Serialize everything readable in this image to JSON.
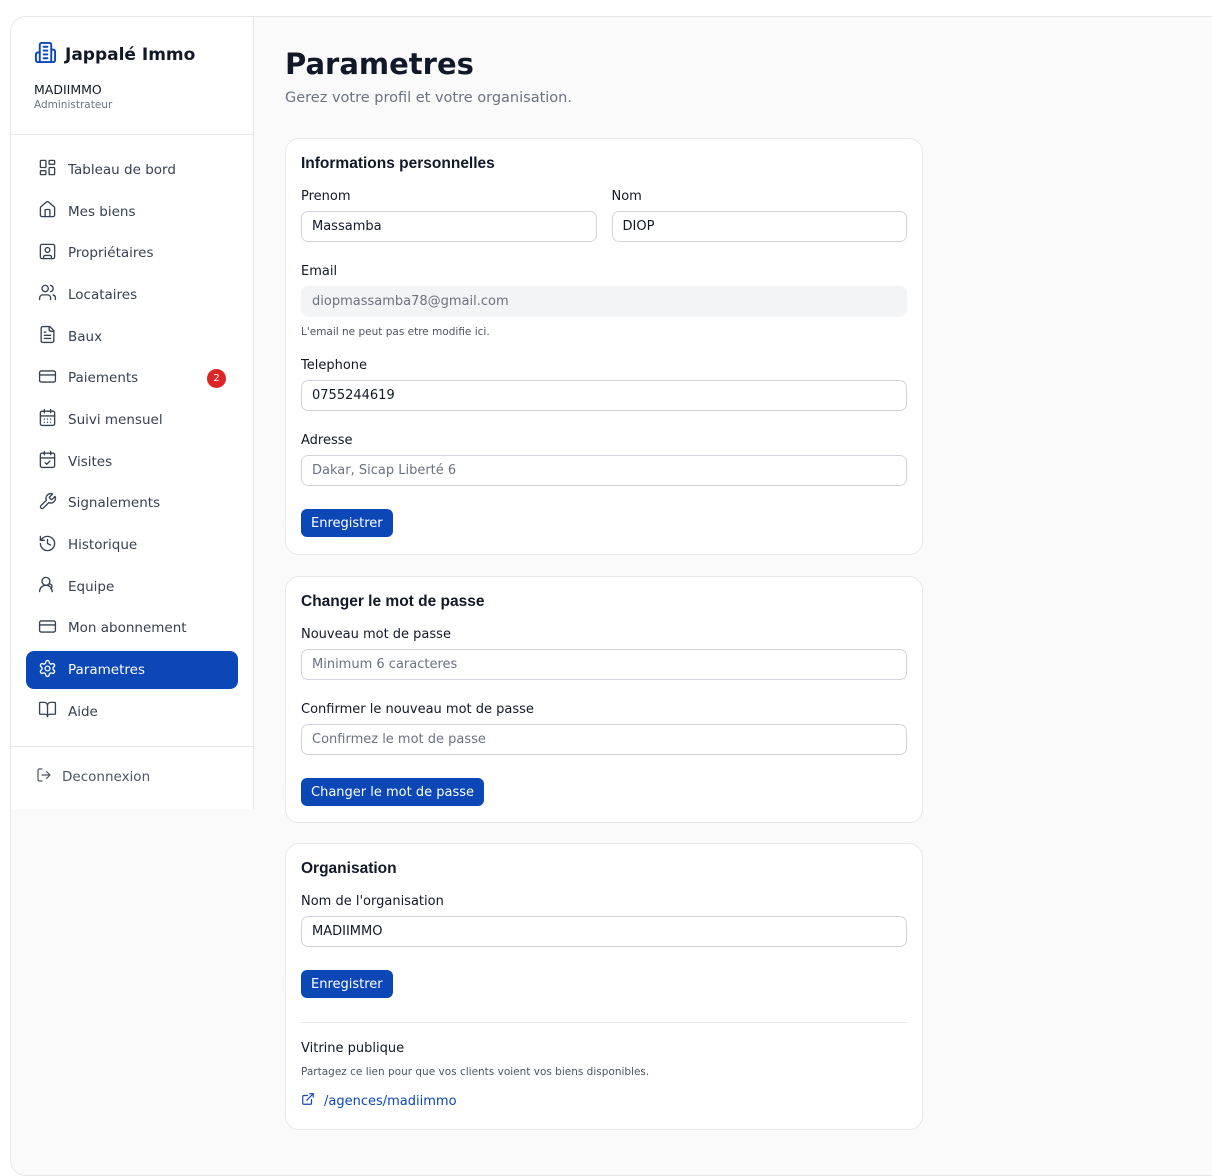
{
  "brand": {
    "name": "Jappalé Immo",
    "org": "MADIIMMO",
    "role": "Administrateur",
    "icon": "building-icon"
  },
  "nav": {
    "items": [
      {
        "label": "Tableau de bord",
        "icon": "dashboard-icon"
      },
      {
        "label": "Mes biens",
        "icon": "home-icon"
      },
      {
        "label": "Propriétaires",
        "icon": "owner-card-icon"
      },
      {
        "label": "Locataires",
        "icon": "users-icon"
      },
      {
        "label": "Baux",
        "icon": "document-icon"
      },
      {
        "label": "Paiements",
        "icon": "credit-card-icon",
        "badge": "2"
      },
      {
        "label": "Suivi mensuel",
        "icon": "calendar-grid-icon"
      },
      {
        "label": "Visites",
        "icon": "calendar-check-icon"
      },
      {
        "label": "Signalements",
        "icon": "wrench-icon"
      },
      {
        "label": "Historique",
        "icon": "history-icon"
      },
      {
        "label": "Equipe",
        "icon": "team-icon"
      },
      {
        "label": "Mon abonnement",
        "icon": "credit-card-icon"
      },
      {
        "label": "Parametres",
        "icon": "gear-icon",
        "active": true
      },
      {
        "label": "Aide",
        "icon": "book-icon"
      }
    ],
    "logout": "Deconnexion"
  },
  "header": {
    "title": "Parametres",
    "subtitle": "Gerez votre profil et votre organisation."
  },
  "personal": {
    "title": "Informations personnelles",
    "first_name_label": "Prenom",
    "first_name": "Massamba",
    "last_name_label": "Nom",
    "last_name": "DIOP",
    "email_label": "Email",
    "email": "diopmassamba78@gmail.com",
    "email_hint": "L'email ne peut pas etre modifie ici.",
    "phone_label": "Telephone",
    "phone": "0755244619",
    "address_label": "Adresse",
    "address_placeholder": "Dakar, Sicap Liberté 6",
    "save": "Enregistrer"
  },
  "password": {
    "title": "Changer le mot de passe",
    "new_label": "Nouveau mot de passe",
    "new_placeholder": "Minimum 6 caracteres",
    "confirm_label": "Confirmer le nouveau mot de passe",
    "confirm_placeholder": "Confirmez le mot de passe",
    "button": "Changer le mot de passe"
  },
  "organisation": {
    "title": "Organisation",
    "name_label": "Nom de l'organisation",
    "name": "MADIIMMO",
    "save": "Enregistrer",
    "vitrine_title": "Vitrine publique",
    "vitrine_desc": "Partagez ce lien pour que vos clients voient vos biens disponibles.",
    "vitrine_link": "/agences/madiimmo"
  },
  "colors": {
    "accent": "#0b47b7",
    "badge": "#dc2626",
    "background": "#fafafa"
  }
}
